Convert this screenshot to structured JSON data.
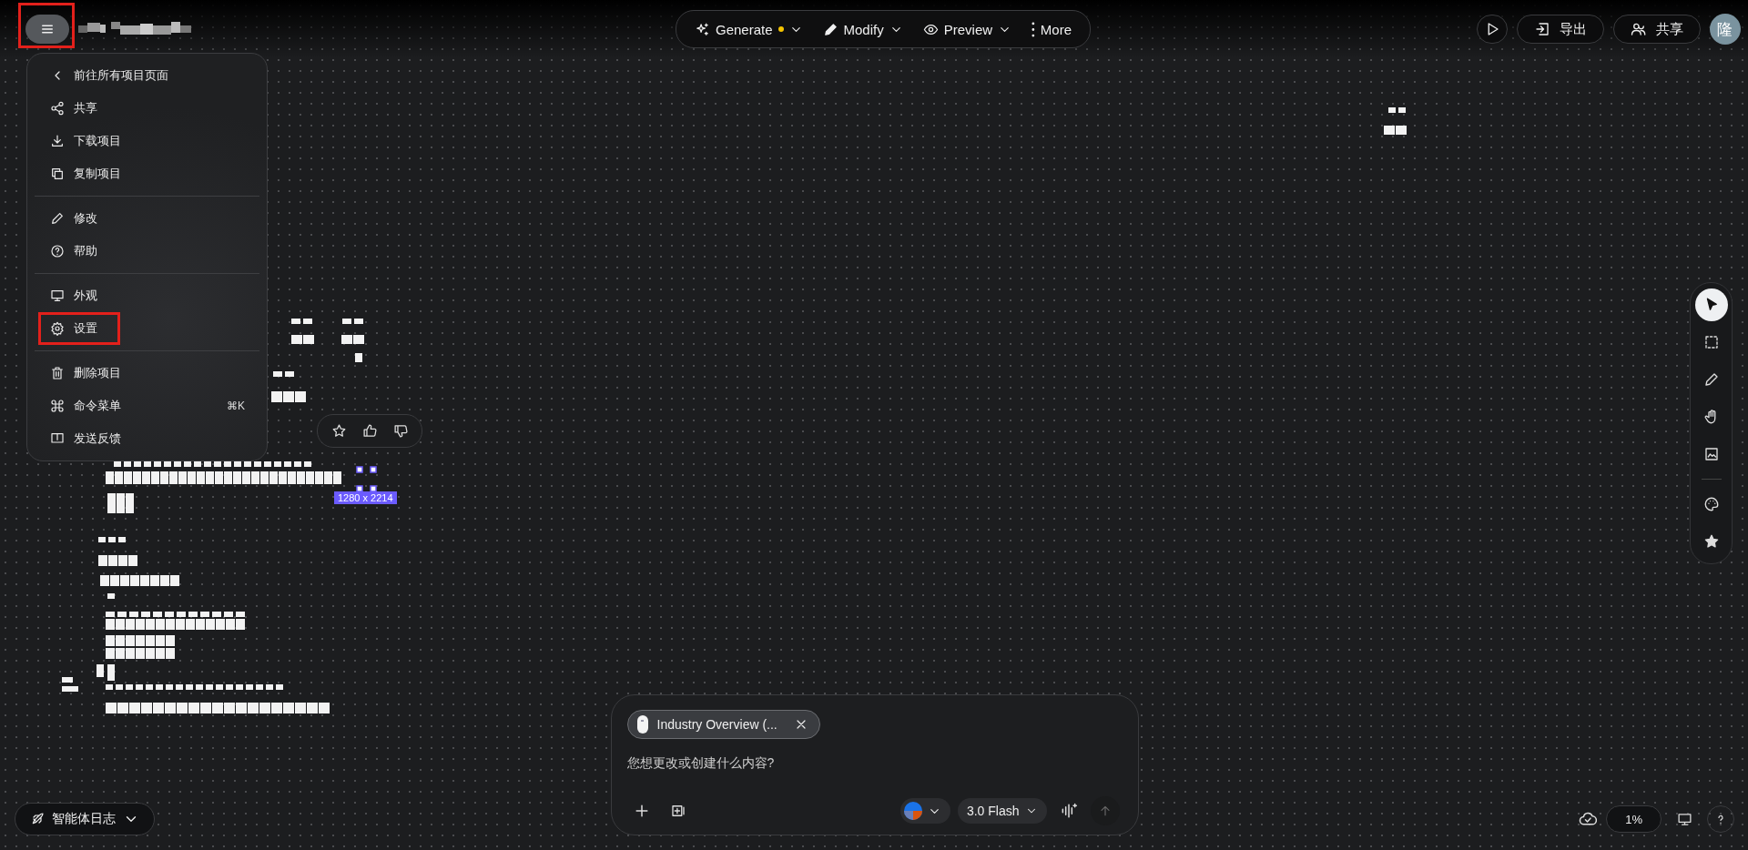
{
  "top_bar": {
    "menu_button": {
      "highlighted": true
    },
    "toolbar": [
      {
        "kind": "generate",
        "label": "Generate",
        "status_dot": true,
        "dropdown": true
      },
      {
        "kind": "modify",
        "label": "Modify",
        "status_dot": false,
        "dropdown": true
      },
      {
        "kind": "preview",
        "label": "Preview",
        "status_dot": false,
        "dropdown": true
      },
      {
        "kind": "more",
        "label": "More",
        "status_dot": false,
        "dropdown": false
      }
    ],
    "actions": [
      {
        "kind": "play"
      },
      {
        "kind": "export",
        "label": "导出"
      },
      {
        "kind": "share",
        "label": "共享"
      }
    ],
    "avatar": "隆"
  },
  "menu": {
    "sections": [
      [
        {
          "kind": "back",
          "label": "前往所有项目页面",
          "highlighted": false
        },
        {
          "kind": "share",
          "label": "共享",
          "highlighted": false
        },
        {
          "kind": "download",
          "label": "下载项目",
          "highlighted": false
        },
        {
          "kind": "copy",
          "label": "复制项目",
          "highlighted": false
        }
      ],
      [
        {
          "kind": "pencil",
          "label": "修改",
          "highlighted": false
        },
        {
          "kind": "help",
          "label": "帮助",
          "highlighted": false
        }
      ],
      [
        {
          "kind": "monitor",
          "label": "外观",
          "highlighted": false
        },
        {
          "kind": "gear",
          "label": "设置",
          "highlighted": true
        }
      ],
      [
        {
          "kind": "trash",
          "label": "删除项目",
          "highlighted": false
        },
        {
          "kind": "command",
          "label": "命令菜单",
          "shortcut": "⌘K",
          "highlighted": false
        },
        {
          "kind": "feedback",
          "label": "发送反馈",
          "highlighted": false
        }
      ]
    ]
  },
  "canvas": {
    "selection_size": "1280 x 2214"
  },
  "tool_rail": {
    "groups": [
      [
        {
          "kind": "pointer",
          "selected": true
        },
        {
          "kind": "marquee",
          "selected": false
        },
        {
          "kind": "pencil",
          "selected": false
        },
        {
          "kind": "hand",
          "selected": false
        },
        {
          "kind": "image",
          "selected": false
        }
      ],
      [
        {
          "kind": "palette",
          "selected": false
        },
        {
          "kind": "star",
          "selected": false
        }
      ]
    ]
  },
  "prompt": {
    "attachment": "Industry Overview (...",
    "placeholder": "您想更改或创建什么内容?",
    "model": "3.0 Flash"
  },
  "agent_log": "智能体日志",
  "zoom": "1%"
}
